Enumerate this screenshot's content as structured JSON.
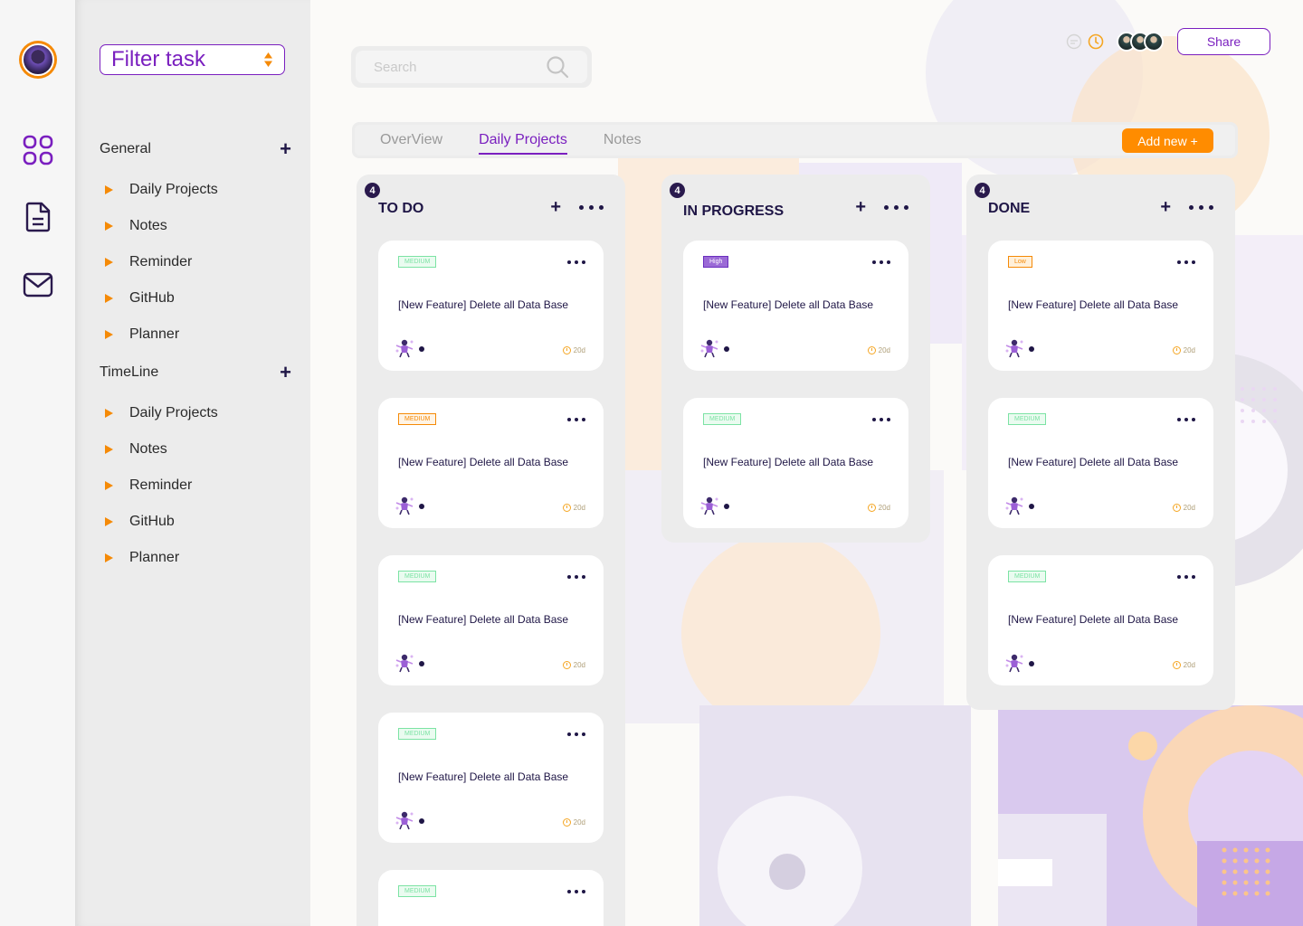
{
  "sidebar": {
    "filter_label": "Filter task",
    "sections": [
      {
        "title": "General",
        "items": [
          "Daily Projects",
          "Notes",
          "Reminder",
          "GitHub",
          "Planner"
        ]
      },
      {
        "title": "TimeLine",
        "items": [
          "Daily Projects",
          "Notes",
          "Reminder",
          "GitHub",
          "Planner"
        ]
      }
    ]
  },
  "rail": {
    "icons": [
      "apps-grid-icon",
      "document-icon",
      "mail-icon"
    ]
  },
  "search": {
    "placeholder": "Search"
  },
  "header": {
    "share_label": "Share"
  },
  "tabs": {
    "items": [
      "OverView",
      "Daily Projects",
      "Notes"
    ],
    "active": "Daily Projects",
    "add_new_label": "Add new +"
  },
  "columns": [
    {
      "title": "TO DO",
      "count": "4",
      "cards": [
        {
          "tag": "MEDIUM",
          "tag_style": "medium-green",
          "title": "[New Feature] Delete all Data Base",
          "time": "20d"
        },
        {
          "tag": "MEDIUM",
          "tag_style": "medium-orange",
          "title": "[New Feature] Delete all Data Base",
          "time": "20d"
        },
        {
          "tag": "MEDIUM",
          "tag_style": "medium-green",
          "title": "[New Feature] Delete all Data Base",
          "time": "20d"
        },
        {
          "tag": "MEDIUM",
          "tag_style": "medium-green",
          "title": "[New Feature] Delete all Data Base",
          "time": "20d"
        },
        {
          "tag": "MEDIUM",
          "tag_style": "medium-green",
          "title": "",
          "time": ""
        }
      ]
    },
    {
      "title": "IN PROGRESS",
      "count": "4",
      "cards": [
        {
          "tag": "High",
          "tag_style": "high",
          "title": "[New Feature] Delete all Data Base",
          "time": "20d"
        },
        {
          "tag": "MEDIUM",
          "tag_style": "medium-green",
          "title": "[New Feature] Delete all Data Base",
          "time": "20d"
        }
      ]
    },
    {
      "title": "DONE",
      "count": "4",
      "cards": [
        {
          "tag": "Low",
          "tag_style": "low",
          "title": "[New Feature] Delete all Data Base",
          "time": "20d"
        },
        {
          "tag": "MEDIUM",
          "tag_style": "medium-green",
          "title": "[New Feature] Delete all Data Base",
          "time": "20d"
        },
        {
          "tag": "MEDIUM",
          "tag_style": "medium-green",
          "title": "[New Feature] Delete all Data Base",
          "time": "20d"
        }
      ]
    }
  ],
  "colors": {
    "accent": "#7a1fbf",
    "orange": "#ff8c00",
    "dark": "#1f1646",
    "panel": "#ececec"
  }
}
